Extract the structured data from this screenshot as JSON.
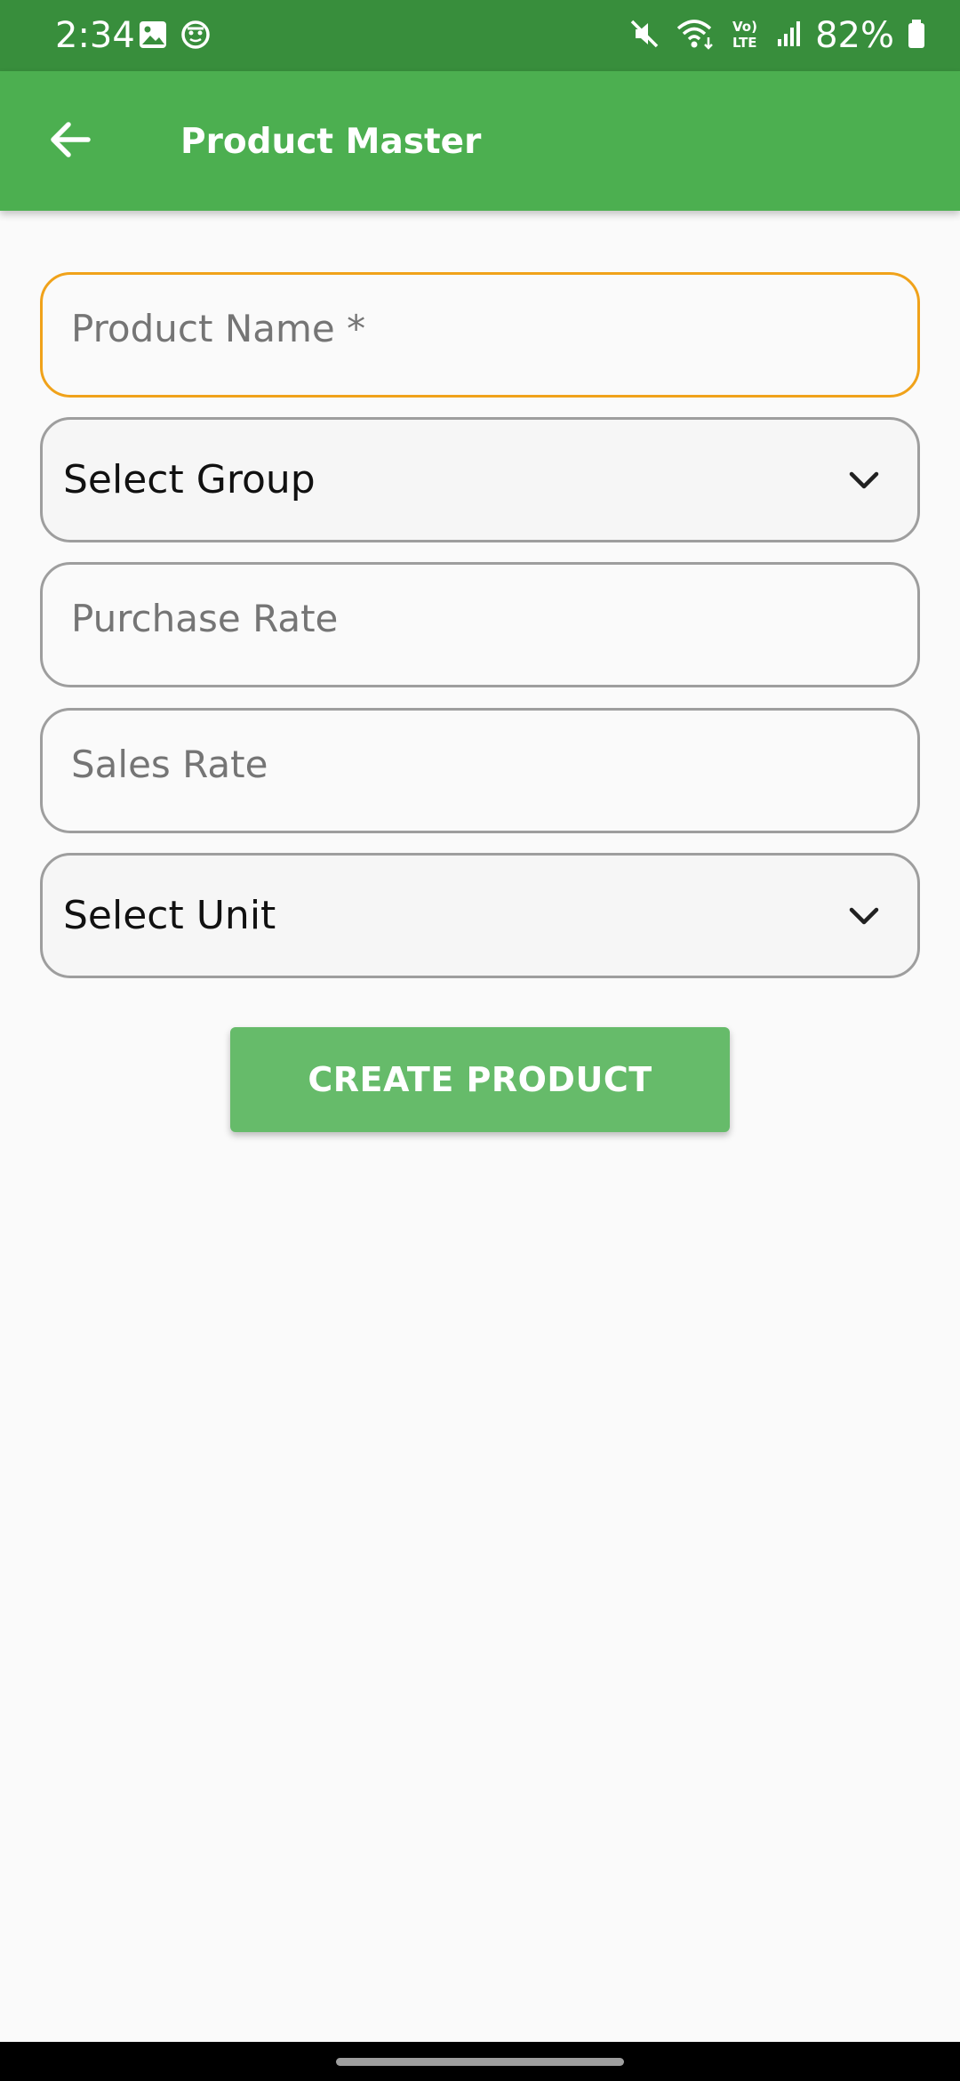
{
  "status_bar": {
    "time": "2:34",
    "battery": "82%",
    "icons": [
      "gallery-icon",
      "app-notification-icon",
      "mute-icon",
      "wifi-icon",
      "volte-icon",
      "signal-icon",
      "battery-icon"
    ]
  },
  "app_bar": {
    "title": "Product Master",
    "back_icon": "arrow-left-icon"
  },
  "form": {
    "product_name_placeholder": "Product Name *",
    "group_label": "Select Group",
    "purchase_rate_placeholder": "Purchase Rate",
    "sales_rate_placeholder": "Sales Rate",
    "unit_label": "Select Unit",
    "submit_label": "CREATE PRODUCT"
  },
  "colors": {
    "status_bar": "#388e3c",
    "app_bar": "#4caf50",
    "button": "#66bb6a",
    "focus_border": "#f0a21a",
    "field_border": "#9e9e9e",
    "background": "#fafafa"
  }
}
